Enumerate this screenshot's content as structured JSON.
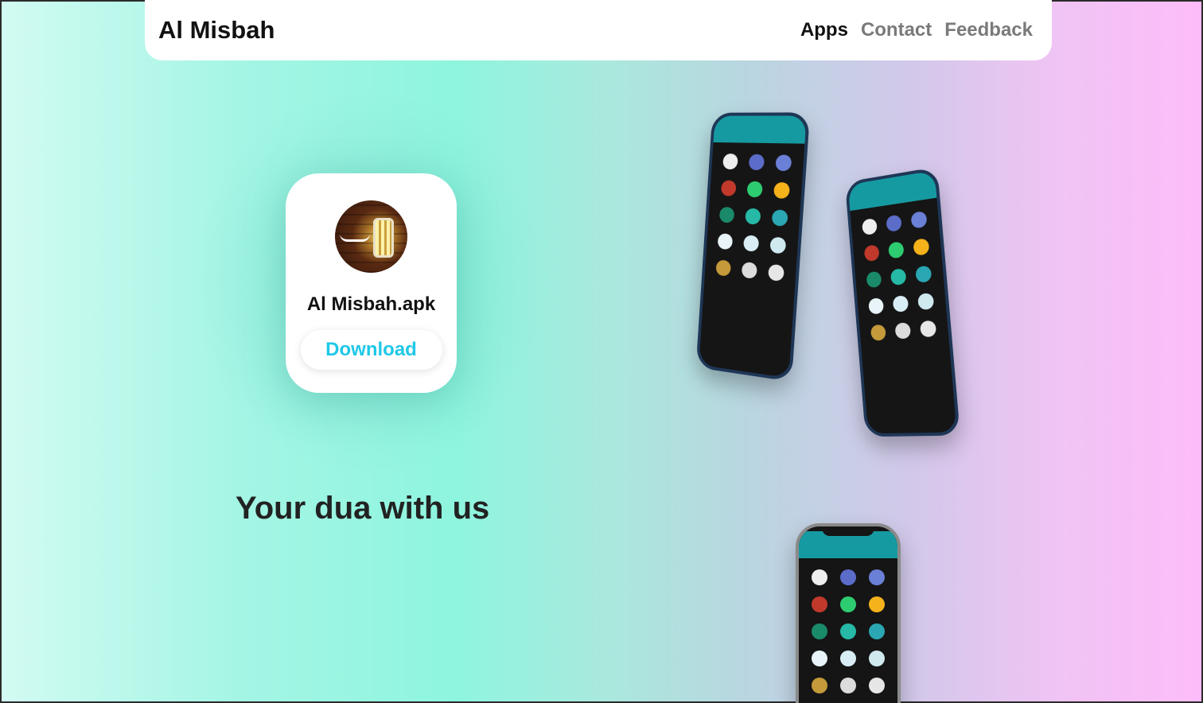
{
  "header": {
    "brand": "Al Misbah",
    "nav": [
      {
        "label": "Apps",
        "active": true
      },
      {
        "label": "Contact",
        "active": false
      },
      {
        "label": "Feedback",
        "active": false
      }
    ]
  },
  "card": {
    "app_name": "Al Misbah.apk",
    "download_label": "Download"
  },
  "tagline": "Your dua with us",
  "colors": {
    "accent": "#1fc8e8",
    "phone_header": "#169aa1",
    "phone_bg": "#151515"
  },
  "icons": {
    "app_icon": "lantern-icon",
    "phone_tiles": [
      "quran-icon",
      "prayer-icon",
      "mosque-icon",
      "candle-icon",
      "green-icon",
      "sun-icon",
      "star-icon",
      "allah-icon",
      "dhikr-icon",
      "salawat-icon",
      "hijab-icon",
      "clock-icon",
      "qibla-icon",
      "counter-icon",
      "others-icon"
    ]
  }
}
